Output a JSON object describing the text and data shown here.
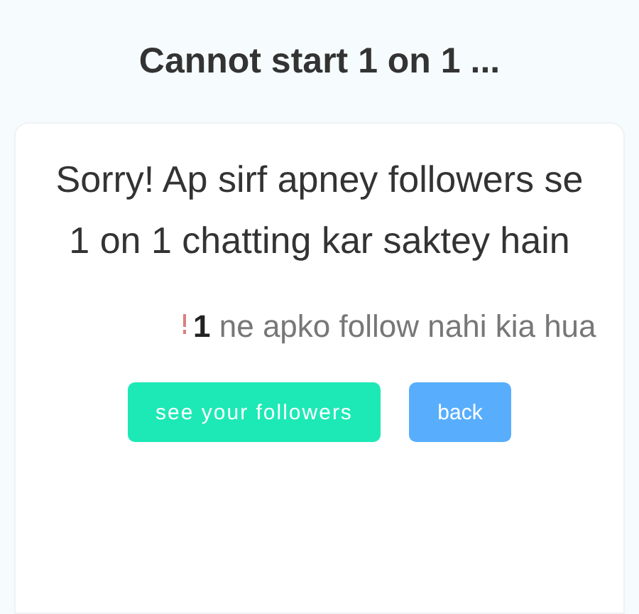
{
  "title": "Cannot start 1 on 1 ...",
  "message": "Sorry! Ap sirf apney followers se 1 on 1 chatting kar saktey hain",
  "notice": "**1** ne apko follow nahi kia hua",
  "buttons": [
    {
      "label": "see your followers",
      "kind": "primary"
    },
    {
      "label": "back",
      "kind": "secondary"
    }
  ]
}
